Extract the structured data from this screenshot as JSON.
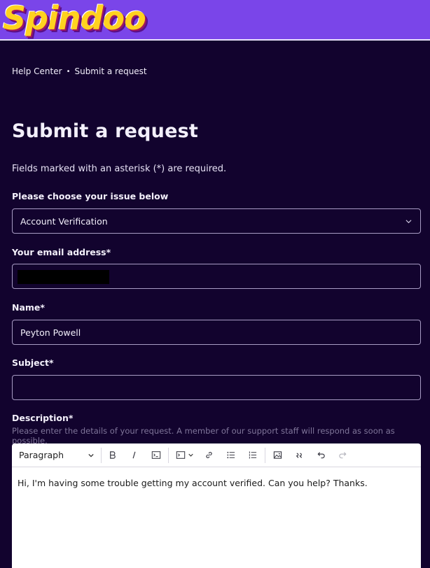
{
  "brand": {
    "logo_text": "Spindoo"
  },
  "breadcrumb": {
    "home": "Help Center",
    "separator": "•",
    "current": "Submit a request"
  },
  "page": {
    "title": "Submit a request",
    "required_note": "Fields marked with an asterisk (*) are required."
  },
  "form": {
    "issue": {
      "label": "Please choose your issue below",
      "value": "Account Verification"
    },
    "email": {
      "label": "Your email address*",
      "value": ""
    },
    "name": {
      "label": "Name*",
      "value": "Peyton Powell"
    },
    "subject": {
      "label": "Subject*",
      "value": ""
    },
    "description": {
      "label": "Description*",
      "help": "Please enter the details of your request. A member of our support staff will respond as soon as possible.",
      "format": "Paragraph",
      "content": "Hi, I'm having some trouble getting my account verified. Can you help? Thanks."
    }
  },
  "colors": {
    "header": "#7a45e9",
    "background": "#12032e",
    "logo": "#ffd21f"
  },
  "toolbar_icons": [
    "bold-icon",
    "italic-icon",
    "code-icon",
    "code-block-icon",
    "link-icon",
    "bulleted-list-icon",
    "numbered-list-icon",
    "image-icon",
    "quote-icon",
    "undo-icon",
    "redo-icon"
  ]
}
